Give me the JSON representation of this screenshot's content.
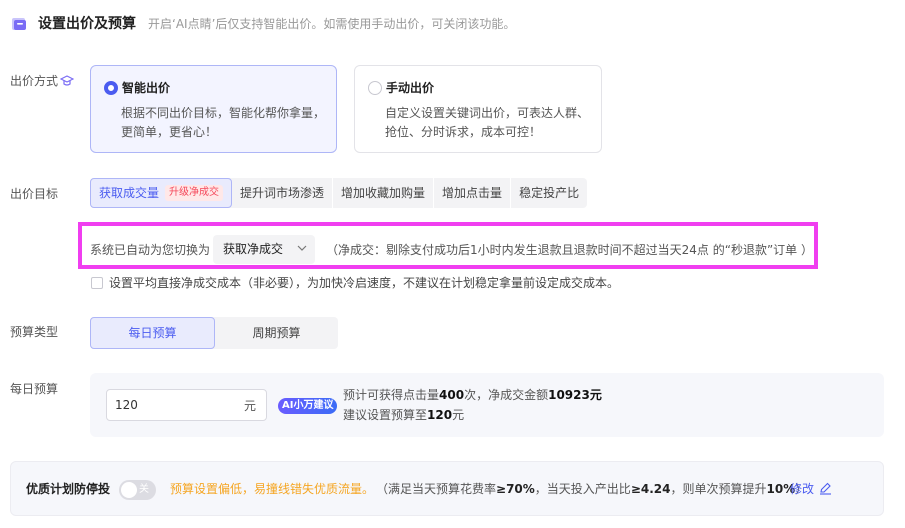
{
  "header": {
    "title": "设置出价及预算",
    "subtitle": "开启‘AI点睛’后仅支持智能出价。如需使用手动出价，可关闭该功能。"
  },
  "bid_method": {
    "label": "出价方式",
    "options": [
      {
        "title": "智能出价",
        "desc_line1": "根据不同出价目标，智能化帮你拿量，",
        "desc_line2": "更简单，更省心！",
        "selected": true
      },
      {
        "title": "手动出价",
        "desc_line1": "自定义设置关键词出价，可表达人群、",
        "desc_line2": "抢位、分时诉求，成本可控！",
        "selected": false
      }
    ]
  },
  "bid_goal": {
    "label": "出价目标",
    "tabs": [
      "获取成交量",
      "提升词市场渗透",
      "增加收藏加购量",
      "增加点击量",
      "稳定投产比"
    ],
    "active_badge": "升级净成交",
    "active_index": 0
  },
  "auto_switch": {
    "prefix": "系统已自动为您切换为",
    "selected": "获取净成交",
    "note": "（净成交：剔除支付成功后1小时内发生退款且退款时间不超过当天24点 的“秒退款”订单 ）"
  },
  "avg_cost": {
    "label": "设置平均直接净成交成本（非必要），为加快冷启速度，不建议在计划稳定拿量前设定成交成本。",
    "checked": false
  },
  "budget_type": {
    "label": "预算类型",
    "options": [
      "每日预算",
      "周期预算"
    ],
    "active_index": 0
  },
  "daily_budget": {
    "label": "每日预算",
    "value": "120",
    "unit": "元",
    "ai_badge": "AI小万建议",
    "est_prefix": "预计可获得点击量",
    "est_clicks": "400",
    "est_mid": "次，净成交金额",
    "est_amount": "10923元",
    "suggest_prefix": "建议设置预算至",
    "suggest_value": "120",
    "suggest_unit": "元"
  },
  "stop_protect": {
    "title": "优质计划防停投",
    "toggle_label": "关",
    "toggle_on": false,
    "warning": "预算设置偏低，易撞线错失优质流量。",
    "rule_a": "（满足当天预算花费率",
    "rule_b": "≥70%",
    "rule_c": "，当天投入产出比",
    "rule_d": "≥4.24",
    "rule_e": "，则单次预算提升",
    "rule_f": "10%",
    "rule_g": "）",
    "edit_label": "修改"
  },
  "colors": {
    "accent": "#4b5cf0",
    "highlight": "#f03ef0",
    "warning": "#f5a623",
    "badge_red": "#f5475a"
  }
}
